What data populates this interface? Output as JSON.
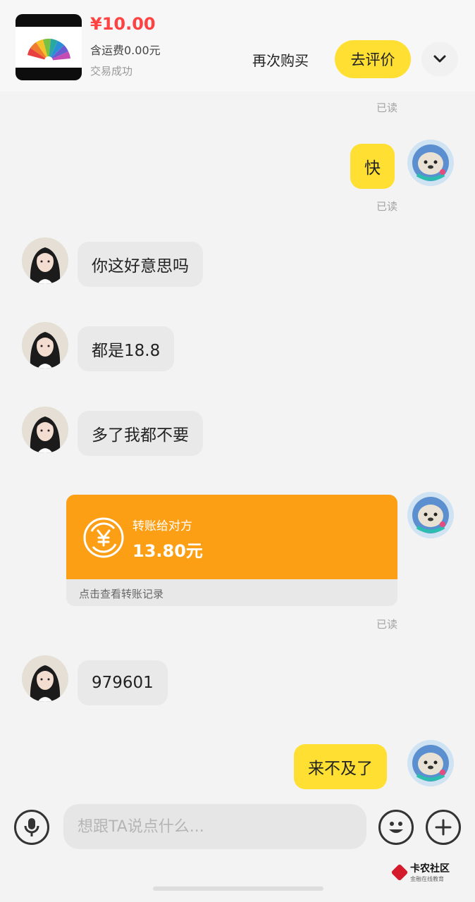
{
  "order": {
    "price": "¥10.00",
    "shipping": "含运费0.00元",
    "status": "交易成功",
    "rebuy_label": "再次购买",
    "review_label": "去评价"
  },
  "messages": {
    "read_label": "已读",
    "out_1": "快",
    "in_1": "你这好意思吗",
    "in_2": "都是18.8",
    "in_3": "多了我都不要",
    "in_4": "979601",
    "out_2": "来不及了"
  },
  "transfer": {
    "title": "转账给对方",
    "amount": "13.80元",
    "footer": "点击查看转账记录"
  },
  "input": {
    "placeholder": "想跟TA说点什么..."
  },
  "watermark": {
    "main": "卡农社区",
    "sub": "金融在线教育"
  },
  "colors": {
    "accent_yellow": "#ffe032",
    "transfer_orange": "#fd9f14",
    "price_red": "#ff4242"
  }
}
